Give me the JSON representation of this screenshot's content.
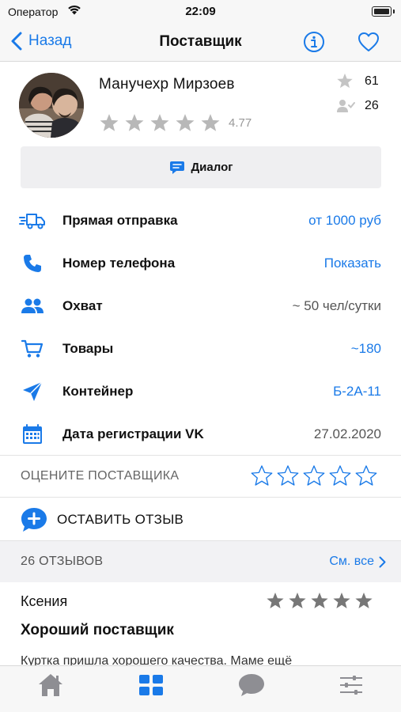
{
  "status_bar": {
    "carrier": "Оператор",
    "time": "22:09"
  },
  "nav": {
    "back_label": "Назад",
    "title": "Поставщик"
  },
  "supplier": {
    "name": "Манучехр Мирзоев",
    "rating": "4.77",
    "stars_filled": 0,
    "stars_total": 5,
    "favorites_count": "61",
    "subscribers_count": "26"
  },
  "dialog_button": {
    "label": "Диалог"
  },
  "details": [
    {
      "icon": "truck-icon",
      "label": "Прямая отправка",
      "value": "от 1000 руб",
      "value_color": "blue"
    },
    {
      "icon": "phone-icon",
      "label": "Номер телефона",
      "value": "Показать",
      "value_color": "blue"
    },
    {
      "icon": "people-icon",
      "label": "Охват",
      "value": "~ 50 чел/сутки",
      "value_color": "gray"
    },
    {
      "icon": "cart-icon",
      "label": "Товары",
      "value": "~180",
      "value_color": "blue"
    },
    {
      "icon": "paper-plane-icon",
      "label": "Контейнер",
      "value": "Б-2А-11",
      "value_color": "blue"
    },
    {
      "icon": "calendar-icon",
      "label": "Дата регистрации VK",
      "value": "27.02.2020",
      "value_color": "gray"
    }
  ],
  "rate_supplier": {
    "label": "ОЦЕНИТЕ ПОСТАВЩИКА",
    "stars_total": 5
  },
  "leave_review": {
    "label": "ОСТАВИТЬ ОТЗЫВ"
  },
  "reviews": {
    "count_label": "26 ОТЗЫВОВ",
    "see_all_label": "См. все",
    "items": [
      {
        "author": "Ксения",
        "title": "Хороший поставщик",
        "text": "Куртка пришла хорошего качества. Маме ещё",
        "stars_total": 5
      }
    ]
  },
  "tabbar": {
    "tabs": [
      {
        "icon": "home-icon",
        "active": false
      },
      {
        "icon": "grid-icon",
        "active": true
      },
      {
        "icon": "chat-bubble-icon",
        "active": false
      },
      {
        "icon": "sliders-icon",
        "active": false
      }
    ]
  },
  "colors": {
    "accent": "#1a7ae8",
    "star_gray": "#b8b8b8",
    "tab_inactive": "#8e8e93"
  }
}
